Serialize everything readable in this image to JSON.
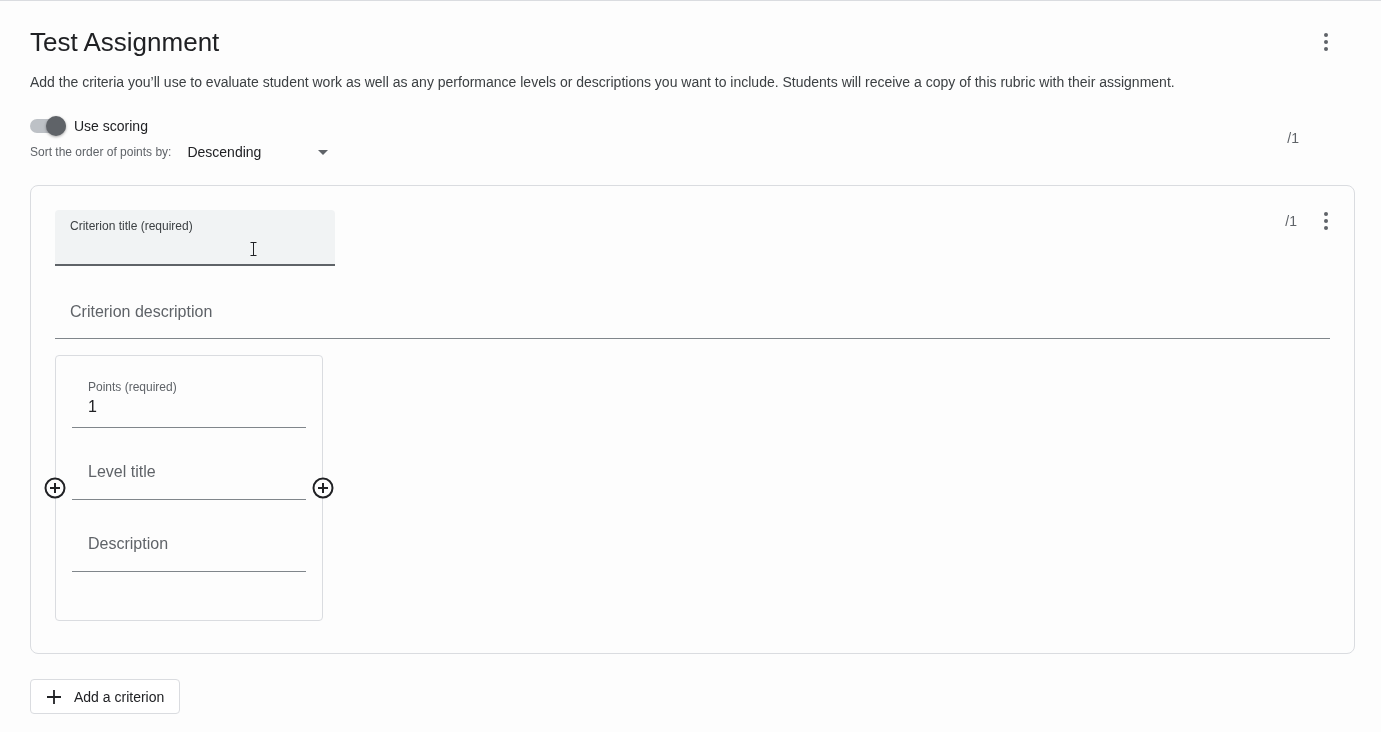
{
  "assignment": {
    "title": "Test Assignment",
    "description": "Add the criteria you’ll use to evaluate student work as well as any performance levels or descriptions you want to include. Students will receive a copy of this rubric with their assignment."
  },
  "scoring": {
    "label": "Use scoring",
    "on": true
  },
  "sort": {
    "label": "Sort the order of points by:",
    "value": "Descending"
  },
  "total_points": "/1",
  "criteria": [
    {
      "title_label": "Criterion title (required)",
      "description_placeholder": "Criterion description",
      "points": "/1",
      "levels": [
        {
          "points_label": "Points (required)",
          "points_value": "1",
          "title_placeholder": "Level title",
          "description_placeholder": "Description"
        }
      ]
    }
  ],
  "add_button": "Add a criterion"
}
